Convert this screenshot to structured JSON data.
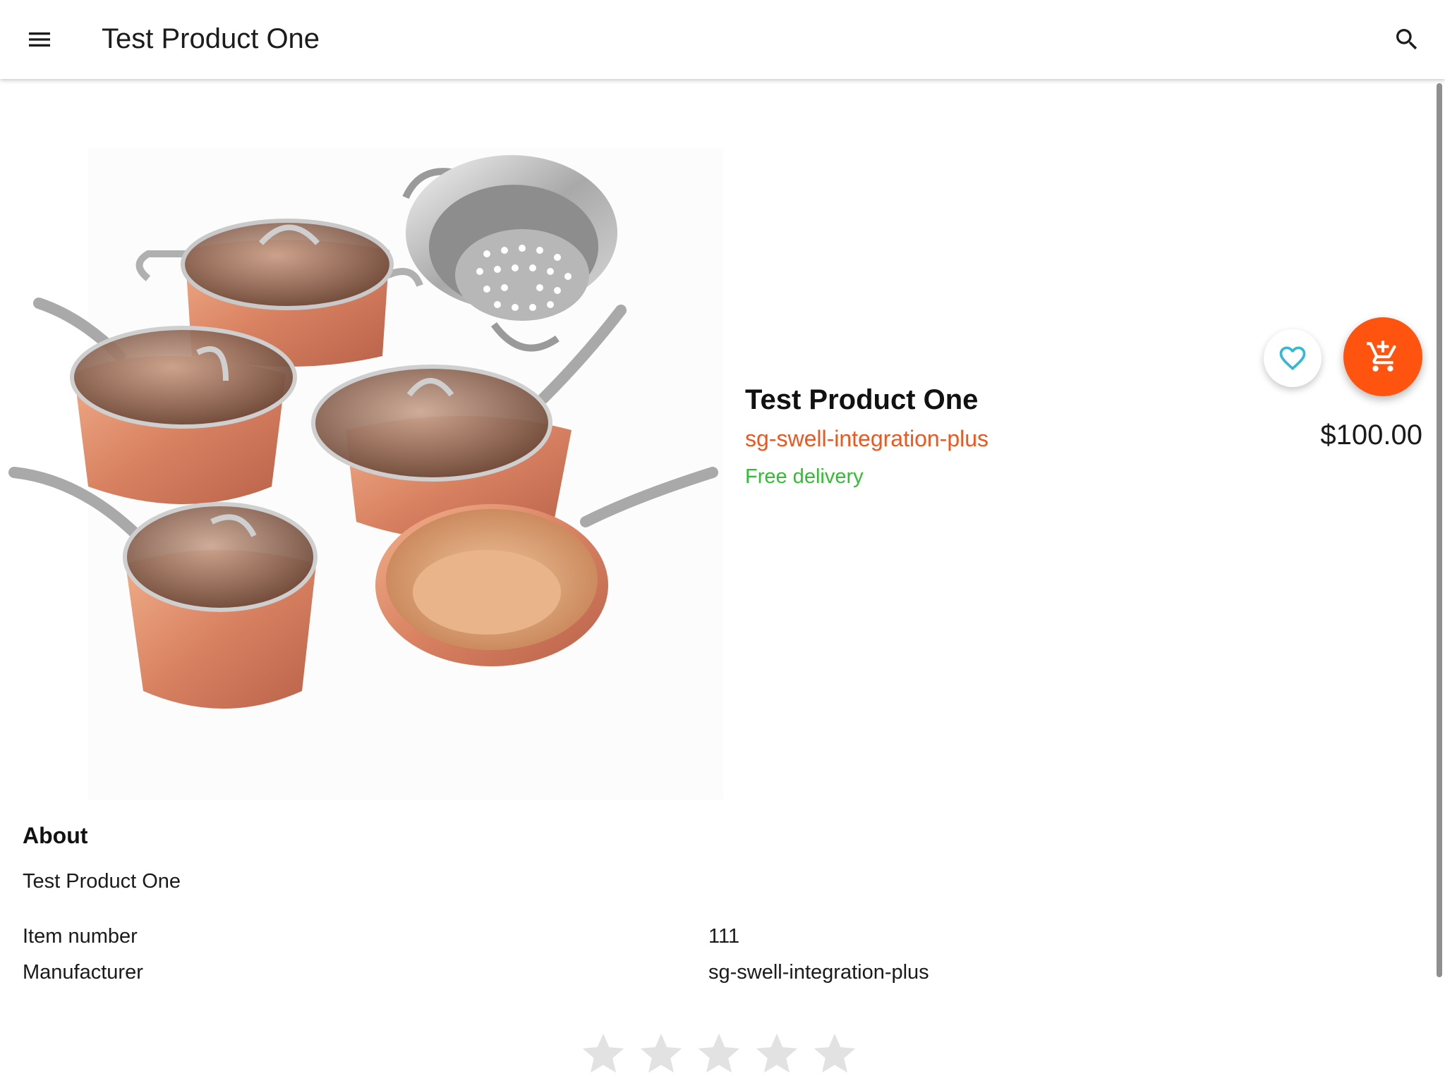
{
  "appbar": {
    "title": "Test Product One",
    "menu_icon": "menu-icon",
    "search_icon": "search-icon"
  },
  "product": {
    "image_alt": "Copper hammered cookware set",
    "name": "Test Product One",
    "vendor": "sg-swell-integration-plus",
    "delivery": "Free delivery",
    "price": "$100.00",
    "favorite_icon": "heart-outline-icon",
    "cart_icon": "add-shopping-cart-icon"
  },
  "about": {
    "heading": "About",
    "description": "Test Product One",
    "specs": [
      {
        "label": "Item number",
        "value": "111"
      },
      {
        "label": "Manufacturer",
        "value": "sg-swell-integration-plus"
      }
    ]
  },
  "rating": {
    "stars_total": 5,
    "stars_filled": 0,
    "star_icon": "star-icon"
  },
  "colors": {
    "accent": "#ff5410",
    "vendor_text": "#f2561d",
    "delivery_text": "#2fbf2f",
    "favorite_icon": "#35b8d4",
    "star_empty": "#e2e2e2"
  }
}
